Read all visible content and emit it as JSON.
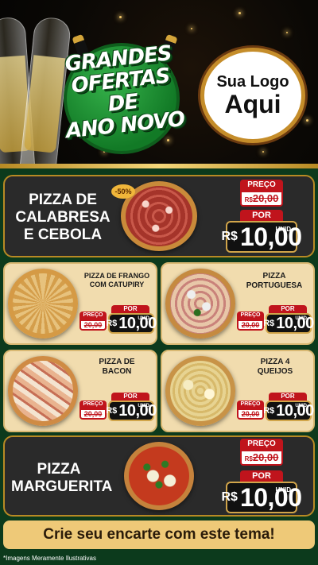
{
  "header": {
    "headline": [
      "GRANDES",
      "OFERTAS DE",
      "ANO NOVO"
    ],
    "logo_line1": "Sua Logo",
    "logo_line2": "Aqui"
  },
  "labels": {
    "preco": "PREÇO",
    "por": "POR",
    "currency": "R$",
    "unid": "UNID"
  },
  "featured": [
    {
      "name_lines": [
        "PIZZA DE",
        "CALABRESA",
        "E CEBOLA"
      ],
      "badge": "-50%",
      "old_price": "20,00",
      "new_price": "10,00",
      "pizza": "calabresa-pizza"
    },
    {
      "name_lines": [
        "PIZZA",
        "MARGUERITA"
      ],
      "old_price": "20,00",
      "new_price": "10,00",
      "pizza": "marguerita-pizza"
    }
  ],
  "items": [
    {
      "name_lines": [
        "PIZZA DE FRANGO",
        "COM CATUPIRY"
      ],
      "old_price": "20,00",
      "new_price": "10,00"
    },
    {
      "name_lines": [
        "PIZZA",
        "PORTUGUESA"
      ],
      "old_price": "20,00",
      "new_price": "10,00"
    },
    {
      "name_lines": [
        "PIZZA DE",
        "BACON"
      ],
      "old_price": "20,00",
      "new_price": "10,00"
    },
    {
      "name_lines": [
        "PIZZA 4",
        "QUEIJOS"
      ],
      "old_price": "20,00",
      "new_price": "10,00"
    }
  ],
  "cta": "Crie seu encarte com este tema!",
  "disclaimer": "*Imagens Meramente Ilustrativas",
  "colors": {
    "accent_red": "#c0141c",
    "gold": "#b88a24",
    "green": "#127a26"
  }
}
